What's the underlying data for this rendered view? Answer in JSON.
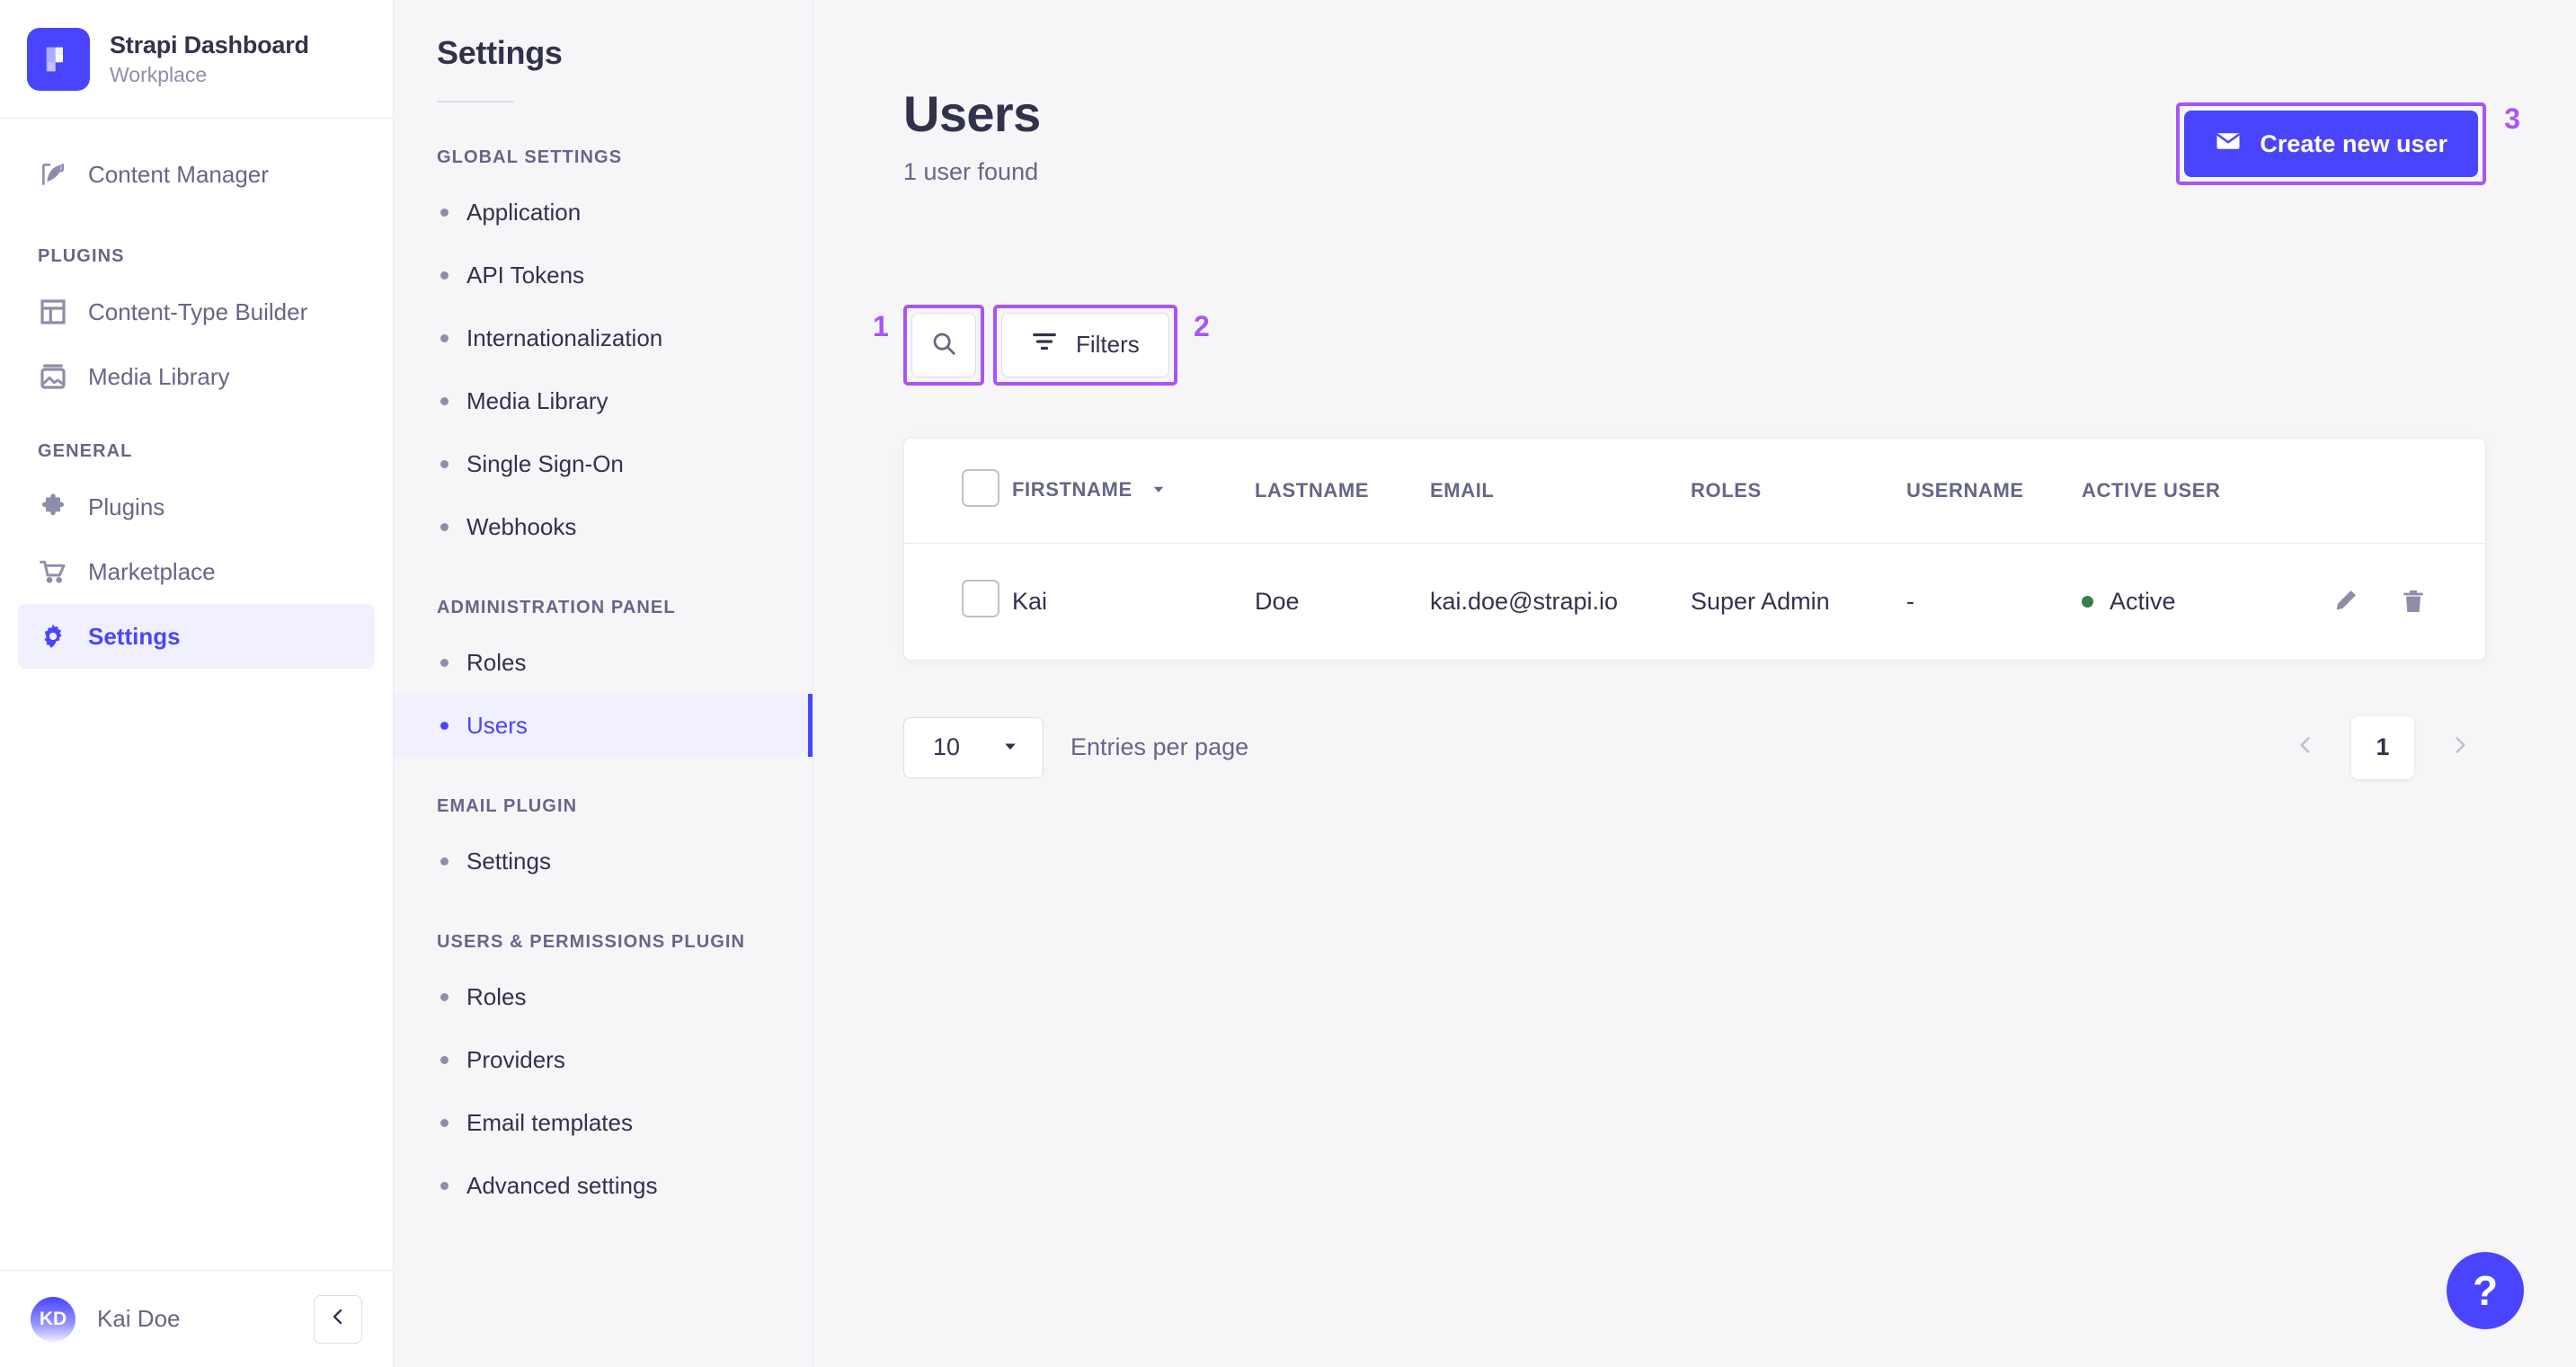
{
  "brand": {
    "title": "Strapi Dashboard",
    "subtitle": "Workplace",
    "logo_icon": "strapi-logo-icon",
    "logo_color": "#4945ff"
  },
  "sidebar": {
    "top_items": [
      {
        "label": "Content Manager",
        "icon": "feather-icon",
        "active": false
      }
    ],
    "sections": [
      {
        "title": "PLUGINS",
        "items": [
          {
            "label": "Content-Type Builder",
            "icon": "layout-icon",
            "active": false
          },
          {
            "label": "Media Library",
            "icon": "image-icon",
            "active": false
          }
        ]
      },
      {
        "title": "GENERAL",
        "items": [
          {
            "label": "Plugins",
            "icon": "puzzle-icon",
            "active": false
          },
          {
            "label": "Marketplace",
            "icon": "shopping-cart-icon",
            "active": false
          },
          {
            "label": "Settings",
            "icon": "gear-icon",
            "active": true
          }
        ]
      }
    ],
    "footer": {
      "avatar_initials": "KD",
      "username": "Kai Doe",
      "collapse_icon": "chevron-left-icon"
    }
  },
  "subnav": {
    "title": "Settings",
    "sections": [
      {
        "title": "GLOBAL SETTINGS",
        "items": [
          {
            "label": "Application",
            "active": false
          },
          {
            "label": "API Tokens",
            "active": false
          },
          {
            "label": "Internationalization",
            "active": false
          },
          {
            "label": "Media Library",
            "active": false
          },
          {
            "label": "Single Sign-On",
            "active": false
          },
          {
            "label": "Webhooks",
            "active": false
          }
        ]
      },
      {
        "title": "ADMINISTRATION PANEL",
        "items": [
          {
            "label": "Roles",
            "active": false
          },
          {
            "label": "Users",
            "active": true
          }
        ]
      },
      {
        "title": "EMAIL PLUGIN",
        "items": [
          {
            "label": "Settings",
            "active": false
          }
        ]
      },
      {
        "title": "USERS & PERMISSIONS PLUGIN",
        "items": [
          {
            "label": "Roles",
            "active": false
          },
          {
            "label": "Providers",
            "active": false
          },
          {
            "label": "Email templates",
            "active": false
          },
          {
            "label": "Advanced settings",
            "active": false
          }
        ]
      }
    ]
  },
  "main": {
    "title": "Users",
    "subtitle": "1 user found",
    "create_button": {
      "label": "Create new user",
      "icon": "envelope-icon",
      "annotation": "3",
      "color": "#4945ff"
    },
    "toolbar": {
      "search_icon": "search-icon",
      "search_annotation": "1",
      "filters_label": "Filters",
      "filters_icon": "filter-icon",
      "filters_annotation": "2"
    },
    "table": {
      "columns": [
        "FIRSTNAME",
        "LASTNAME",
        "EMAIL",
        "ROLES",
        "USERNAME",
        "ACTIVE USER"
      ],
      "sorted_column": "FIRSTNAME",
      "sort_icon": "caret-down-icon",
      "rows": [
        {
          "firstname": "Kai",
          "lastname": "Doe",
          "email": "kai.doe@strapi.io",
          "roles": "Super Admin",
          "username": "-",
          "active": "Active",
          "active_color": "#328048",
          "edit_icon": "pencil-icon",
          "delete_icon": "trash-icon"
        }
      ]
    },
    "pagination": {
      "page_size": "10",
      "entries_label": "Entries per page",
      "prev_icon": "chevron-left-icon",
      "next_icon": "chevron-right-icon",
      "current_page": "1"
    },
    "help_button": {
      "label": "?",
      "icon": "question-mark-icon"
    }
  },
  "annotation_color": "#a855f7"
}
